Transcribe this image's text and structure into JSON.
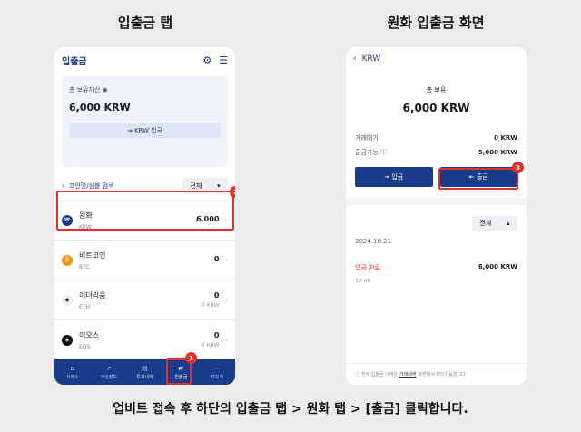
{
  "captions": {
    "left": "입출금 탭",
    "right": "원화 입출금 화면",
    "footer": "업비트 접속 후 하단의 입출금 탭 > 원화 탭 > [출금] 클릭합니다."
  },
  "left_phone": {
    "title": "입출금",
    "icons": [
      "gear-icon",
      "chat-icon"
    ],
    "asset": {
      "label": "총 보유자산",
      "value": "6,000 KRW",
      "deposit_button": "KRW 입금"
    },
    "search_placeholder": "코인명/심볼 검색",
    "filter": "전체",
    "coins": [
      {
        "name": "원화",
        "symbol": "KRW",
        "amount": "6,000",
        "sub": "",
        "color": "#1a3a8a",
        "glyph": "₩"
      },
      {
        "name": "비트코인",
        "symbol": "BTC",
        "amount": "0",
        "sub": "",
        "color": "#f7931a",
        "glyph": "₿"
      },
      {
        "name": "이더리움",
        "symbol": "ETH",
        "amount": "0",
        "sub": "0 KRW",
        "color": "#eeeeee",
        "glyph": "◆"
      },
      {
        "name": "이오스",
        "symbol": "EOS",
        "amount": "0",
        "sub": "0 KRW",
        "color": "#111111",
        "glyph": "◈"
      }
    ],
    "tabs": [
      {
        "label": "거래소",
        "icon": "chart-icon"
      },
      {
        "label": "코인정보",
        "icon": "chart-line-icon"
      },
      {
        "label": "투자내역",
        "icon": "wallet-icon"
      },
      {
        "label": "입출금",
        "icon": "transfer-icon"
      },
      {
        "label": "더보기",
        "icon": "grid-icon"
      }
    ],
    "badges": [
      "1",
      "2"
    ]
  },
  "right_phone": {
    "back_label": "KRW",
    "total_label": "총 보유",
    "total_value": "6,000 KRW",
    "rows": [
      {
        "label": "거래대기",
        "value": "0 KRW"
      },
      {
        "label": "출금가능",
        "value": "5,000 KRW"
      }
    ],
    "deposit_button": "입금",
    "withdraw_button": "출금",
    "badge": "3",
    "filter": "전체",
    "date": "2024.10.21",
    "tx_status": "입금 완료",
    "tx_amount": "6,000 KRW",
    "tx_time": "19:40",
    "note_prefix": "전체 입출금 내역은",
    "note_link": "거래내역",
    "note_suffix": "화면에서 확인가능합니다."
  }
}
